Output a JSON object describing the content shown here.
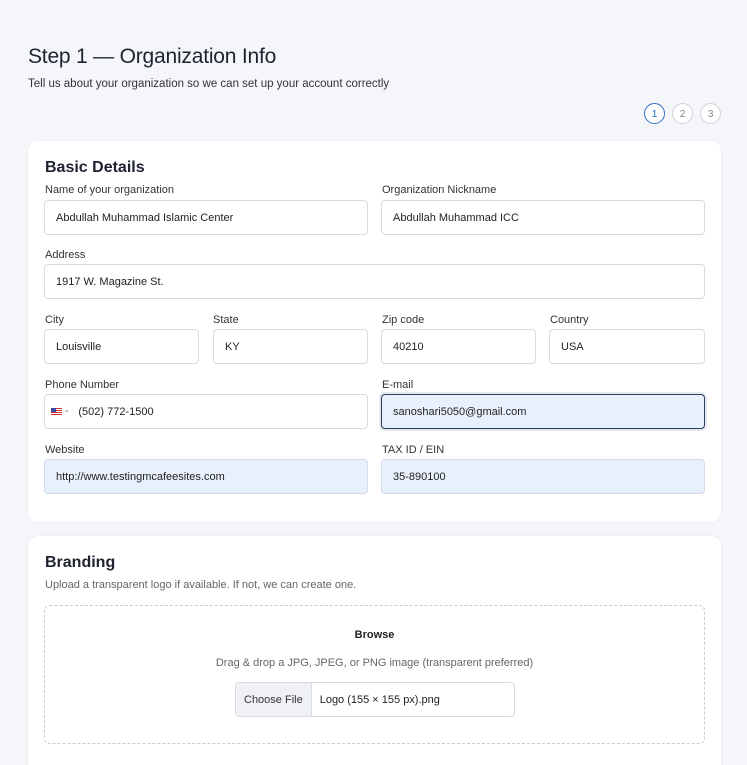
{
  "header": {
    "title": "Step 1 — Organization Info",
    "subtitle": "Tell us about your organization so we can set up your account correctly"
  },
  "stepper": {
    "steps": [
      "1",
      "2",
      "3"
    ],
    "active_step": 1
  },
  "basic": {
    "title": "Basic Details",
    "fields": {
      "org_name": {
        "label": "Name of your organization",
        "value": "Abdullah Muhammad Islamic Center"
      },
      "nickname": {
        "label": "Organization Nickname",
        "value": "Abdullah Muhammad ICC"
      },
      "address": {
        "label": "Address",
        "value": "1917 W. Magazine St."
      },
      "city": {
        "label": "City",
        "value": "Louisville"
      },
      "state": {
        "label": "State",
        "value": "KY"
      },
      "zip": {
        "label": "Zip code",
        "value": "40210"
      },
      "country": {
        "label": "Country",
        "value": "USA"
      },
      "phone": {
        "label": "Phone Number",
        "country_separator": "-",
        "value": "(502) 772-1500"
      },
      "email": {
        "label": "E-mail",
        "value": "sanoshari5050@gmail.com"
      },
      "website": {
        "label": "Website",
        "value": "http://www.testingmcafeesites.com"
      },
      "tax_id": {
        "label": "TAX ID / EIN",
        "value": "35-890100"
      }
    }
  },
  "branding": {
    "title": "Branding",
    "subtitle": "Upload a transparent logo if available. If not, we can create one.",
    "dropzone": {
      "title": "Browse",
      "hint": "Drag & drop a JPG, JPEG, or PNG image (transparent preferred)",
      "button_label": "Choose File",
      "file_name": "Logo (155 × 155 px).png"
    }
  },
  "colors": {
    "accent": "#2f6fc4",
    "autofill_bg": "#e8f0fd",
    "page_bg": "#f4f6fa"
  }
}
